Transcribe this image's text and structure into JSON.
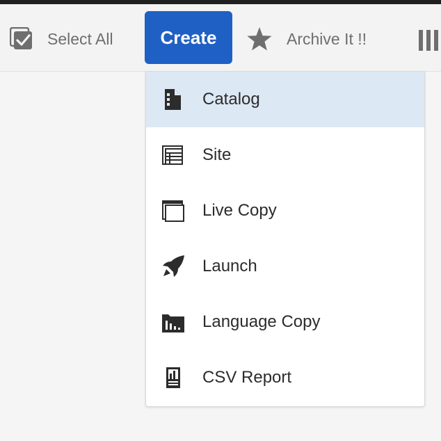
{
  "toolbar": {
    "select_all_label": "Select All",
    "create_label": "Create",
    "archive_label": "Archive It !!",
    "icons": {
      "select_all": "checkbox-check-icon",
      "archive": "star-icon",
      "view": "column-view-icon"
    },
    "accent_color": "#1f60c4"
  },
  "menu": {
    "items": [
      {
        "label": "Catalog",
        "icon": "catalog-icon",
        "selected": true
      },
      {
        "label": "Site",
        "icon": "site-icon",
        "selected": false
      },
      {
        "label": "Live Copy",
        "icon": "live-copy-icon",
        "selected": false
      },
      {
        "label": "Launch",
        "icon": "launch-rocket-icon",
        "selected": false
      },
      {
        "label": "Language Copy",
        "icon": "language-copy-icon",
        "selected": false
      },
      {
        "label": "CSV Report",
        "icon": "csv-report-icon",
        "selected": false
      }
    ],
    "selected_bg": "#dde8f5"
  }
}
